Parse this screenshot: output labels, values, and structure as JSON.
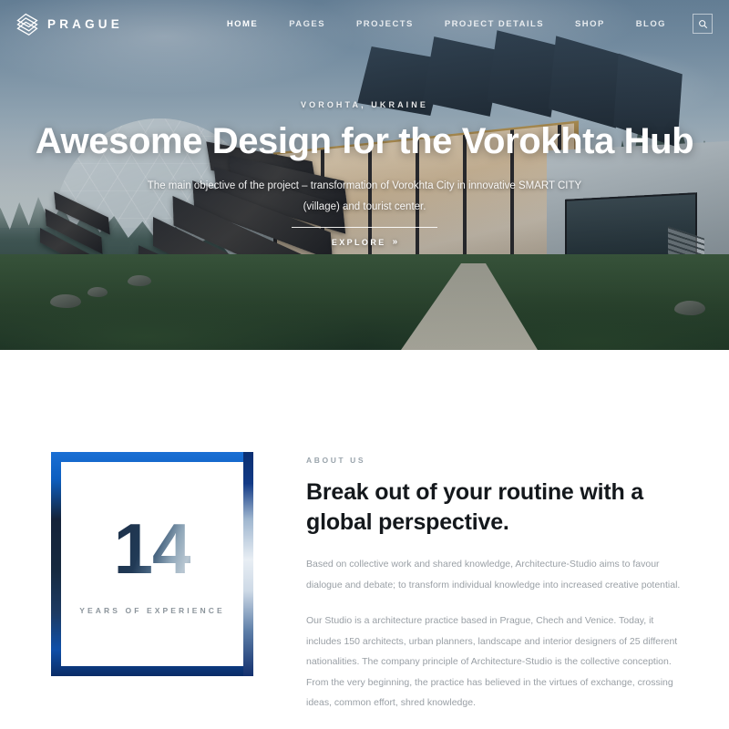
{
  "brand": {
    "name": "PRAGUE",
    "logo_icon": "layered-hexagon-logo-icon"
  },
  "nav": {
    "items": [
      {
        "label": "HOME",
        "active": true
      },
      {
        "label": "PAGES",
        "active": false
      },
      {
        "label": "PROJECTS",
        "active": false
      },
      {
        "label": "PROJECT DETAILS",
        "active": false
      },
      {
        "label": "SHOP",
        "active": false
      },
      {
        "label": "BLOG",
        "active": false
      }
    ],
    "search_icon": "search-icon"
  },
  "hero": {
    "location": "VOROHTA, UKRAINE",
    "title": "Awesome Design for the Vorokhta Hub",
    "description": "The main objective of the project – transformation of Vorokhta City in innovative SMART CITY (village) and tourist center.",
    "cta_label": "EXPLORE",
    "cta_arrow": "»"
  },
  "about": {
    "eyebrow": "ABOUT US",
    "heading": "Break out of your routine with a global perspective.",
    "paragraph_1": "Based on collective work and shared knowledge, Architecture-Studio aims to favour dialogue and debate; to transform individual knowledge into increased creative potential.",
    "paragraph_2": "Our Studio is a architecture practice based in Prague, Chech and Venice. Today, it includes 150 architects, urban planners, landscape and interior designers of 25 different nationalities. The company principle of Architecture-Studio is the collective conception. From the very beginning, the practice has believed in the virtues of exchange, crossing ideas, common effort, shred knowledge.",
    "stat_number": "14",
    "stat_label": "YEARS OF EXPERIENCE"
  },
  "colors": {
    "accent_blue": "#0d5fc0",
    "frame_dark": "#15233a",
    "heading": "#14181c",
    "body_text": "#9aa0a6",
    "nav_text": "#ffffff"
  }
}
